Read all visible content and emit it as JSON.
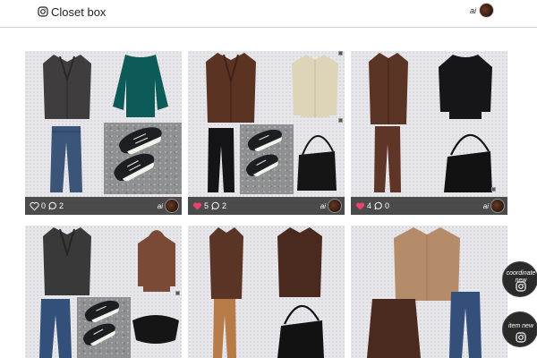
{
  "header": {
    "brand_icon": "instagram-icon",
    "title": "Closet box",
    "user_name": "ai"
  },
  "cards": [
    {
      "likes": "0",
      "comments": "2",
      "liked": false,
      "user_name": "ai"
    },
    {
      "likes": "5",
      "comments": "2",
      "liked": true,
      "user_name": "ai"
    },
    {
      "likes": "4",
      "comments": "0",
      "liked": true,
      "user_name": "ai"
    }
  ],
  "fab": {
    "coordinate_label_1": "coordinate",
    "coordinate_label_2": "new",
    "item_label": "item new",
    "icon": "instagram-icon"
  },
  "colors": {
    "heart_liked": "#e8436a",
    "footer_bg": "#282828",
    "fab_bg": "#2a2a2a"
  }
}
